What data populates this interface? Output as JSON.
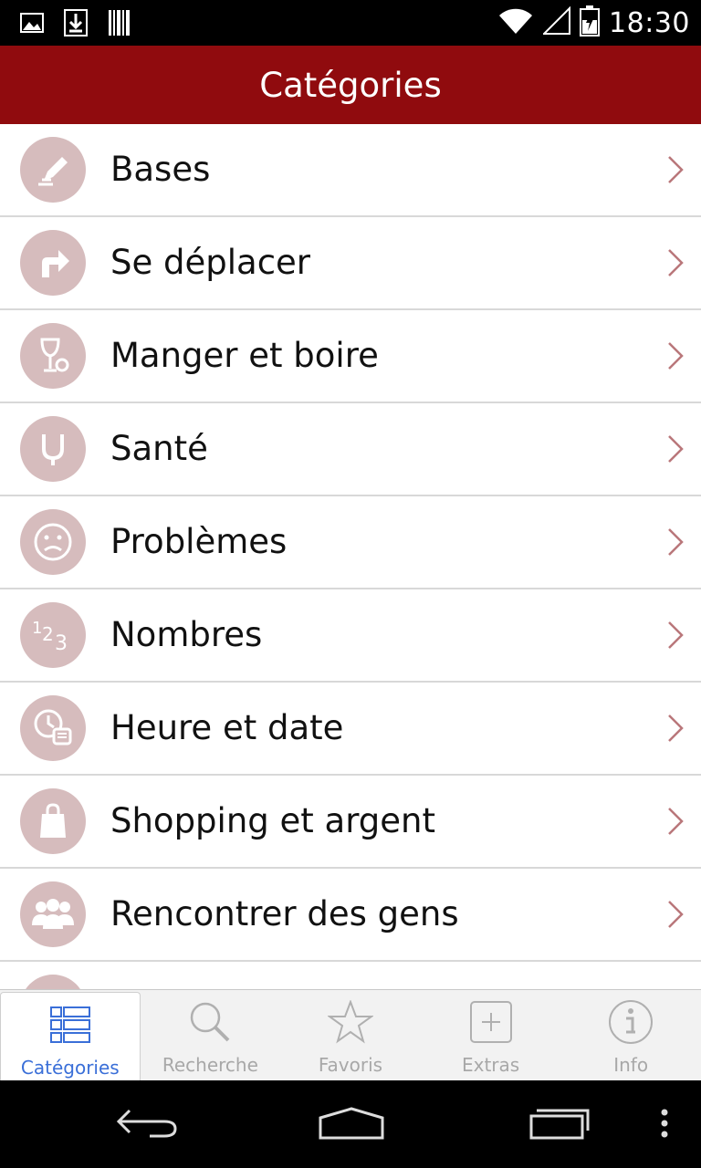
{
  "status_bar": {
    "time": "18:30",
    "icons": [
      "gallery-icon",
      "download-icon",
      "barcode-icon",
      "wifi-icon",
      "signal-icon",
      "battery-icon"
    ]
  },
  "app_bar": {
    "title": "Catégories"
  },
  "categories": [
    {
      "label": "Bases",
      "icon": "pencil-icon"
    },
    {
      "label": "Se déplacer",
      "icon": "turn-right-arrow-icon"
    },
    {
      "label": "Manger et boire",
      "icon": "glass-cup-icon"
    },
    {
      "label": "Santé",
      "icon": "stethoscope-icon"
    },
    {
      "label": "Problèmes",
      "icon": "sad-face-icon"
    },
    {
      "label": "Nombres",
      "icon": "numbers-icon"
    },
    {
      "label": "Heure et date",
      "icon": "clock-calendar-icon"
    },
    {
      "label": "Shopping et argent",
      "icon": "shopping-bag-icon"
    },
    {
      "label": "Rencontrer des gens",
      "icon": "people-icon"
    }
  ],
  "tabs": [
    {
      "label": "Catégories",
      "icon": "list-grid-icon",
      "active": true
    },
    {
      "label": "Recherche",
      "icon": "search-icon",
      "active": false
    },
    {
      "label": "Favoris",
      "icon": "star-icon",
      "active": false
    },
    {
      "label": "Extras",
      "icon": "plus-box-icon",
      "active": false
    },
    {
      "label": "Info",
      "icon": "info-icon",
      "active": false
    }
  ],
  "colors": {
    "accent": "#900b0e",
    "icon_circle": "#d6bcbd",
    "chevron": "#b9777a",
    "active_tab": "#3a6fd8",
    "inactive_tab": "#a8a8a8"
  }
}
